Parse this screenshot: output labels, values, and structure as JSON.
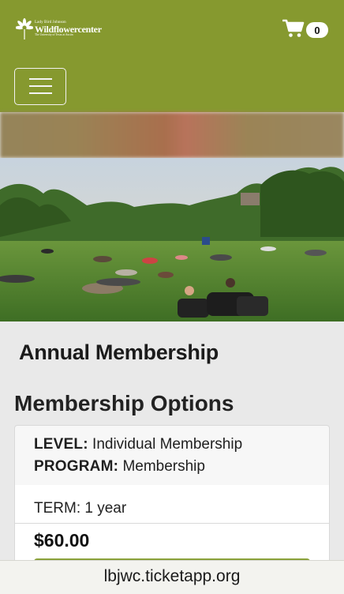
{
  "header": {
    "logo": {
      "line1": "Lady Bird Johnson",
      "line2": "Wildflowercenter",
      "line3": "The University of Texas at Austin"
    },
    "cart": {
      "icon": "cart-icon",
      "count": "0"
    },
    "menu": {
      "icon": "hamburger-icon"
    }
  },
  "page": {
    "title": "Annual Membership",
    "section_title": "Membership Options"
  },
  "option": {
    "level_label": "LEVEL:",
    "level_value": "Individual Membership",
    "program_label": "PROGRAM:",
    "program_value": "Membership",
    "term": "TERM: 1 year",
    "price": "$60.00"
  },
  "browser": {
    "url": "lbjwc.ticketapp.org"
  },
  "colors": {
    "header": "#86992f",
    "background": "#e9e9e9",
    "button": "#8aa13a"
  }
}
